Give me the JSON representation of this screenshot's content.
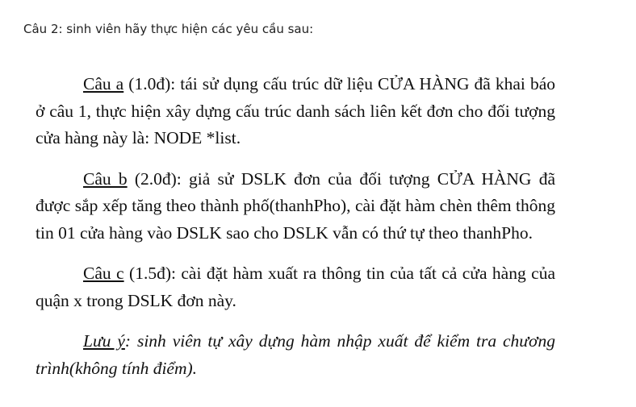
{
  "header": "Câu 2: sinh viên hãy thực hiện các yêu cầu sau:",
  "paragraphs": [
    {
      "label": "Câu a",
      "text": " (1.0đ): tái sử dụng cấu trúc dữ liệu CỬA HÀNG đã khai báo ở câu 1, thực hiện xây dựng cấu trúc danh sách liên kết đơn cho đối tượng cửa hàng này là:  NODE *list."
    },
    {
      "label": "Câu b",
      "text": " (2.0đ): giả sử DSLK đơn của đối tượng CỬA HÀNG đã được sắp xếp tăng theo thành phố(thanhPho), cài đặt hàm chèn thêm thông tin 01 cửa hàng vào DSLK sao cho DSLK vẫn có thứ tự theo thanhPho."
    },
    {
      "label": "Câu c",
      "text": " (1.5đ): cài đặt hàm xuất ra thông tin của tất cả cửa hàng của quận x trong DSLK đơn này."
    }
  ],
  "note": {
    "label": "Lưu ý",
    "text": ": sinh viên tự xây dựng hàm nhập xuất để kiểm tra chương trình(không tính điểm)."
  }
}
